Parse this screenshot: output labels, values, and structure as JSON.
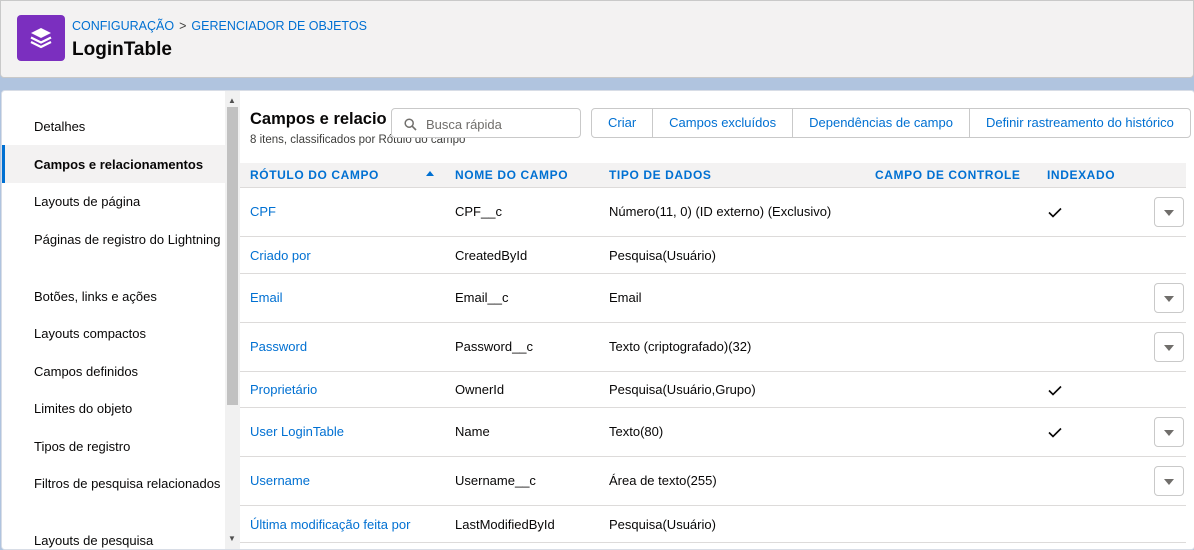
{
  "header": {
    "breadcrumb": [
      "CONFIGURAÇÃO",
      "GERENCIADOR DE OBJETOS"
    ],
    "breadcrumb_sep": ">",
    "title": "LoginTable",
    "icon": "layers-icon",
    "icon_color": "#7b2fbf"
  },
  "sidebar": {
    "items": [
      {
        "label": "Detalhes",
        "active": false
      },
      {
        "label": "Campos e relacionamentos",
        "active": true
      },
      {
        "label": "Layouts de página",
        "active": false
      },
      {
        "label": "Páginas de registro do Lightning",
        "active": false
      },
      {
        "label": "Botões, links e ações",
        "active": false
      },
      {
        "label": "Layouts compactos",
        "active": false
      },
      {
        "label": "Campos definidos",
        "active": false
      },
      {
        "label": "Limites do objeto",
        "active": false
      },
      {
        "label": "Tipos de registro",
        "active": false
      },
      {
        "label": "Filtros de pesquisa relacionados",
        "active": false
      },
      {
        "label": "Layouts de pesquisa",
        "active": false
      }
    ]
  },
  "main": {
    "title": "Campos e relacio",
    "subtitle": "8 itens, classificados por Rótulo do campo",
    "search": {
      "placeholder": "Busca rápida",
      "icon": "search-icon"
    },
    "buttons": [
      "Criar",
      "Campos excluídos",
      "Dependências de campo",
      "Definir rastreamento do histórico"
    ],
    "table": {
      "columns": [
        "RÓTULO DO CAMPO",
        "NOME DO CAMPO",
        "TIPO DE DADOS",
        "CAMPO DE CONTROLE",
        "INDEXADO"
      ],
      "sorted_by": "RÓTULO DO CAMPO",
      "sort_direction": "ascending",
      "rows": [
        {
          "label": "CPF",
          "name": "CPF__c",
          "type": "Número(11, 0) (ID externo) (Exclusivo)",
          "control": "",
          "indexed": true,
          "menu": true
        },
        {
          "label": "Criado por",
          "name": "CreatedById",
          "type": "Pesquisa(Usuário)",
          "control": "",
          "indexed": false,
          "menu": false
        },
        {
          "label": "Email",
          "name": "Email__c",
          "type": "Email",
          "control": "",
          "indexed": false,
          "menu": true
        },
        {
          "label": "Password",
          "name": "Password__c",
          "type": "Texto (criptografado)(32)",
          "control": "",
          "indexed": false,
          "menu": true
        },
        {
          "label": "Proprietário",
          "name": "OwnerId",
          "type": "Pesquisa(Usuário,Grupo)",
          "control": "",
          "indexed": true,
          "menu": false
        },
        {
          "label": "User LoginTable",
          "name": "Name",
          "type": "Texto(80)",
          "control": "",
          "indexed": true,
          "menu": true
        },
        {
          "label": "Username",
          "name": "Username__c",
          "type": "Área de texto(255)",
          "control": "",
          "indexed": false,
          "menu": true
        },
        {
          "label": "Última modificação feita por",
          "name": "LastModifiedById",
          "type": "Pesquisa(Usuário)",
          "control": "",
          "indexed": false,
          "menu": false
        }
      ]
    }
  },
  "colors": {
    "link": "#0070d2",
    "brand": "#7b2fbf",
    "background": "#b0c4df"
  }
}
